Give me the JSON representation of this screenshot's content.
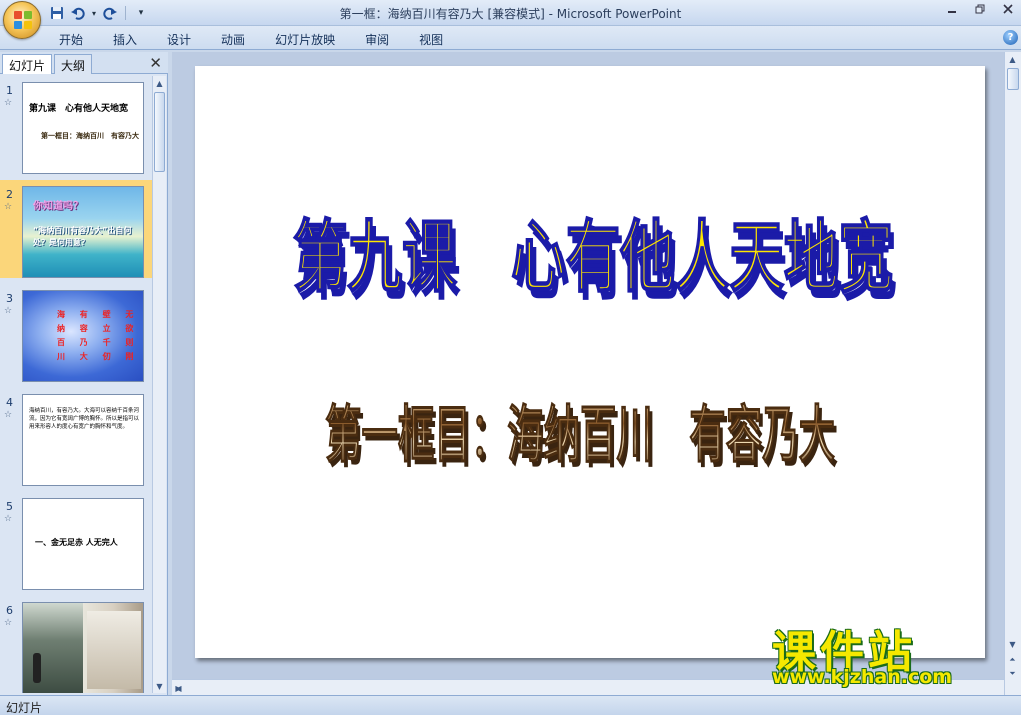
{
  "app": {
    "title": "第一框：海纳百川有容乃大 [兼容模式] - Microsoft PowerPoint"
  },
  "ribbon": {
    "tabs": [
      "开始",
      "插入",
      "设计",
      "动画",
      "幻灯片放映",
      "审阅",
      "视图"
    ]
  },
  "left_pane": {
    "tab_slides": "幻灯片",
    "tab_outline": "大纲",
    "slides": [
      {
        "num": "1",
        "lines": [
          "第九课　心有他人天地宽",
          "第一框目：海纳百川　有容乃大"
        ]
      },
      {
        "num": "2",
        "lines": [
          "你知道吗？",
          "“海纳百川有容乃大”出自何处？是何用意？"
        ]
      },
      {
        "num": "3",
        "lines": [
          "海 有 壁 无",
          "纳 容 立 欲",
          "百 乃 千 则",
          "川 大 仞 刚"
        ]
      },
      {
        "num": "4",
        "lines": [
          "海纳百川，有容乃大。大海可以容纳千百条河流，因为它有宽阔广博的胸怀。所以是指可以用来形容人的度心有宽广的胸怀和气度。"
        ]
      },
      {
        "num": "5",
        "lines": [
          "一、金无足赤 人无完人"
        ]
      },
      {
        "num": "6",
        "lines": []
      }
    ]
  },
  "slide": {
    "title": "第九课　心有他人天地宽",
    "subtitle": "第一框目：海纳百川　有容乃大"
  },
  "status": {
    "view_label": "幻灯片"
  },
  "watermark": {
    "cn": "课件站",
    "url": "www.kjzhan.com"
  }
}
